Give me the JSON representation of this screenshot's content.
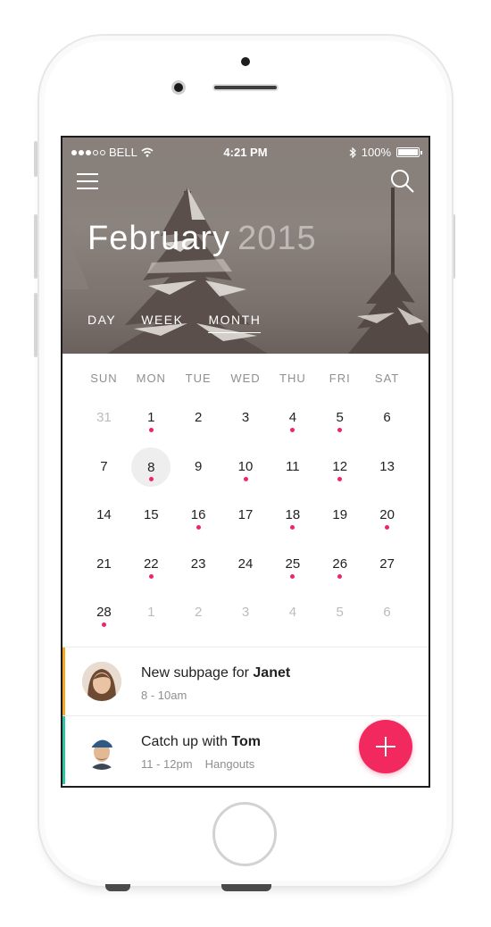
{
  "status_bar": {
    "carrier": "BELL",
    "time": "4:21 PM",
    "battery": "100%",
    "signal_dots": [
      true,
      true,
      true,
      false,
      false
    ]
  },
  "header": {
    "month": "February",
    "year": "2015",
    "views": [
      {
        "label": "DAY",
        "active": false
      },
      {
        "label": "WEEK",
        "active": false
      },
      {
        "label": "MONTH",
        "active": true
      }
    ]
  },
  "calendar": {
    "weekdays": [
      "SUN",
      "MON",
      "TUE",
      "WED",
      "THU",
      "FRI",
      "SAT"
    ],
    "weeks": [
      [
        {
          "d": "31",
          "muted": true
        },
        {
          "d": "1",
          "ev": true
        },
        {
          "d": "2"
        },
        {
          "d": "3"
        },
        {
          "d": "4",
          "ev": true
        },
        {
          "d": "5",
          "ev": true
        },
        {
          "d": "6"
        }
      ],
      [
        {
          "d": "7"
        },
        {
          "d": "8",
          "ev": true,
          "selected": true
        },
        {
          "d": "9"
        },
        {
          "d": "10",
          "ev": true
        },
        {
          "d": "11"
        },
        {
          "d": "12",
          "ev": true
        },
        {
          "d": "13"
        }
      ],
      [
        {
          "d": "14"
        },
        {
          "d": "15"
        },
        {
          "d": "16",
          "ev": true
        },
        {
          "d": "17"
        },
        {
          "d": "18",
          "ev": true
        },
        {
          "d": "19"
        },
        {
          "d": "20",
          "ev": true
        }
      ],
      [
        {
          "d": "21"
        },
        {
          "d": "22",
          "ev": true
        },
        {
          "d": "23"
        },
        {
          "d": "24"
        },
        {
          "d": "25",
          "ev": true
        },
        {
          "d": "26",
          "ev": true
        },
        {
          "d": "27"
        }
      ],
      [
        {
          "d": "28",
          "ev": true
        },
        {
          "d": "1",
          "muted": true
        },
        {
          "d": "2",
          "muted": true
        },
        {
          "d": "3",
          "muted": true
        },
        {
          "d": "4",
          "muted": true
        },
        {
          "d": "5",
          "muted": true
        },
        {
          "d": "6",
          "muted": true
        }
      ]
    ],
    "accent_color": "#f0246a"
  },
  "events": [
    {
      "title_prefix": "New subpage for ",
      "title_name": "Janet",
      "time": "8 - 10am",
      "location": "",
      "color": "#f5a623"
    },
    {
      "title_prefix": "Catch up with ",
      "title_name": "Tom",
      "time": "11 - 12pm",
      "location": "Hangouts",
      "color": "#2ec4a6"
    }
  ],
  "fab": {
    "icon": "plus-icon",
    "color": "#f2295f"
  }
}
